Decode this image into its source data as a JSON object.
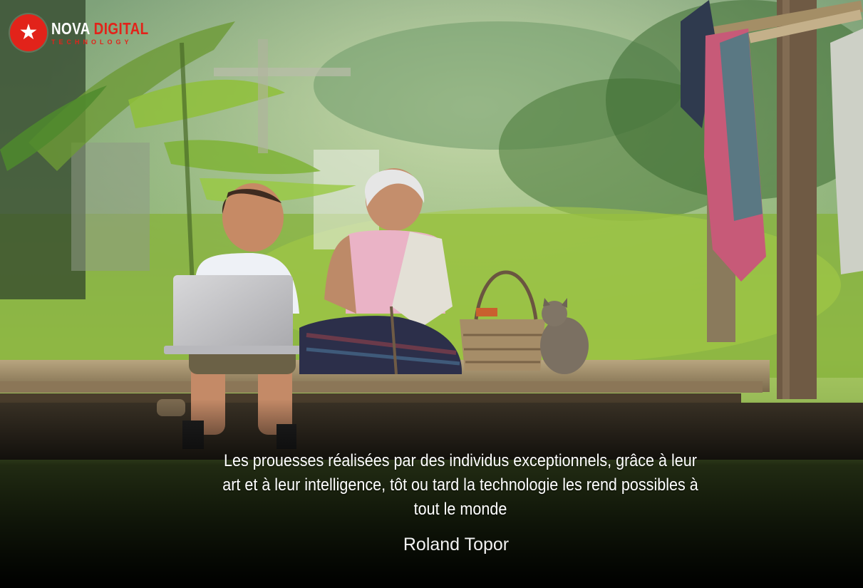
{
  "brand": {
    "name_part1": "NOVA",
    "name_part2": "DIGITAL",
    "tagline": "TECHNOLOGY",
    "logo_icon": "star-swoosh-icon",
    "accent_color": "#e2231a"
  },
  "quote": {
    "text": "Les prouesses réalisées par des individus exceptionnels, grâce à leur art et à leur intelligence, tôt ou tard la technologie les rend possibles à tout le monde",
    "author": "Roland Topor"
  }
}
